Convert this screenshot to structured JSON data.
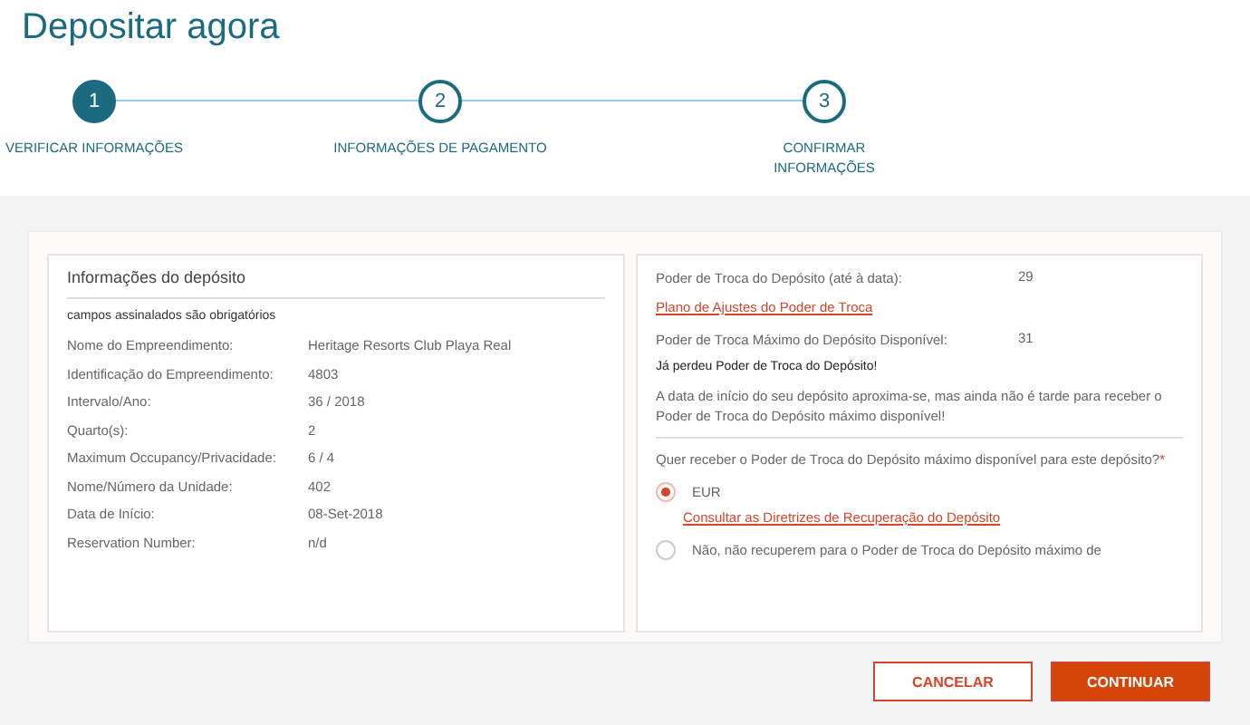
{
  "title": "Depositar agora",
  "steps": [
    {
      "number": "1",
      "label": "VERIFICAR INFORMAÇÕES",
      "selected": true
    },
    {
      "number": "2",
      "label": "INFORMAÇÕES DE PAGAMENTO",
      "selected": false
    },
    {
      "number": "3",
      "label": "CONFIRMAR INFORMAÇÕES",
      "selected": false
    }
  ],
  "deposit_info": {
    "heading": "Informações do depósito",
    "required_note": "campos assinalados são obrigatórios",
    "fields": [
      {
        "label": "Nome do Empreendimento:",
        "value": "Heritage Resorts Club Playa Real"
      },
      {
        "label": "Identificação do Empreendimento:",
        "value": "4803"
      },
      {
        "label": "Intervalo/Ano:",
        "value": "36 / 2018"
      },
      {
        "label": "Quarto(s):",
        "value": "2"
      },
      {
        "label": "Maximum Occupancy/Privacidade:",
        "value": "6 / 4"
      },
      {
        "label": "Nome/Número da Unidade:",
        "value": "402"
      },
      {
        "label": "Data de Início:",
        "value": "08-Set-2018"
      },
      {
        "label": "Reservation Number:",
        "value": "n/d"
      }
    ]
  },
  "trading_power": {
    "current_label": "Poder de Troca do Depósito (até à data):",
    "current_value": "29",
    "plan_link": "Plano de Ajustes do Poder de Troca",
    "max_label": "Poder de Troca Máximo do Depósito Disponível:",
    "max_value": "31",
    "alert_title": "Já perdeu Poder de Troca do Depósito!",
    "alert_text": "A data de início do seu depósito aproxima-se, mas ainda não é tarde para receber o Poder de Troca do Depósito máximo disponível!",
    "question": "Quer receber o Poder de Troca do Depósito máximo disponível para este depósito?",
    "required_mark": "*",
    "options": [
      {
        "label": "EUR",
        "selected": true,
        "link": "Consultar as Diretrizes de Recuperação do Depósito"
      },
      {
        "label": "Não, não recuperem para o Poder de Troca do Depósito máximo de",
        "selected": false
      }
    ]
  },
  "buttons": {
    "cancel": "CANCELAR",
    "continue": "CONTINUAR"
  }
}
